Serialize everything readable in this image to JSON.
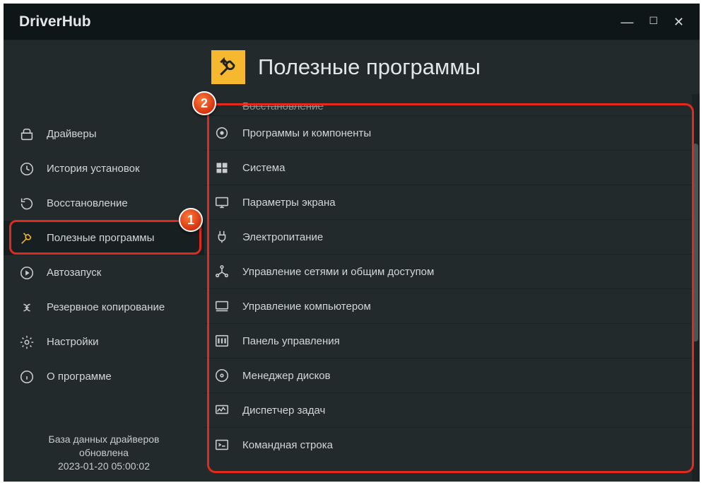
{
  "app_title": "DriverHub",
  "page_title": "Полезные программы",
  "sidebar": {
    "items": [
      {
        "label": "Драйверы"
      },
      {
        "label": "История установок"
      },
      {
        "label": "Восстановление"
      },
      {
        "label": "Полезные программы"
      },
      {
        "label": "Автозапуск"
      },
      {
        "label": "Резервное копирование"
      },
      {
        "label": "Настройки"
      },
      {
        "label": "О программе"
      }
    ],
    "footer_line1": "База данных драйверов",
    "footer_line2": "обновлена",
    "footer_line3": "2023-01-20 05:00:02"
  },
  "tools": [
    {
      "label": "Восстановление"
    },
    {
      "label": "Программы и компоненты"
    },
    {
      "label": "Система"
    },
    {
      "label": "Параметры экрана"
    },
    {
      "label": "Электропитание"
    },
    {
      "label": "Управление сетями и общим доступом"
    },
    {
      "label": "Управление компьютером"
    },
    {
      "label": "Панель управления"
    },
    {
      "label": "Менеджер дисков"
    },
    {
      "label": "Диспетчер задач"
    },
    {
      "label": "Командная строка"
    }
  ],
  "annotations": {
    "badge1": "1",
    "badge2": "2"
  }
}
